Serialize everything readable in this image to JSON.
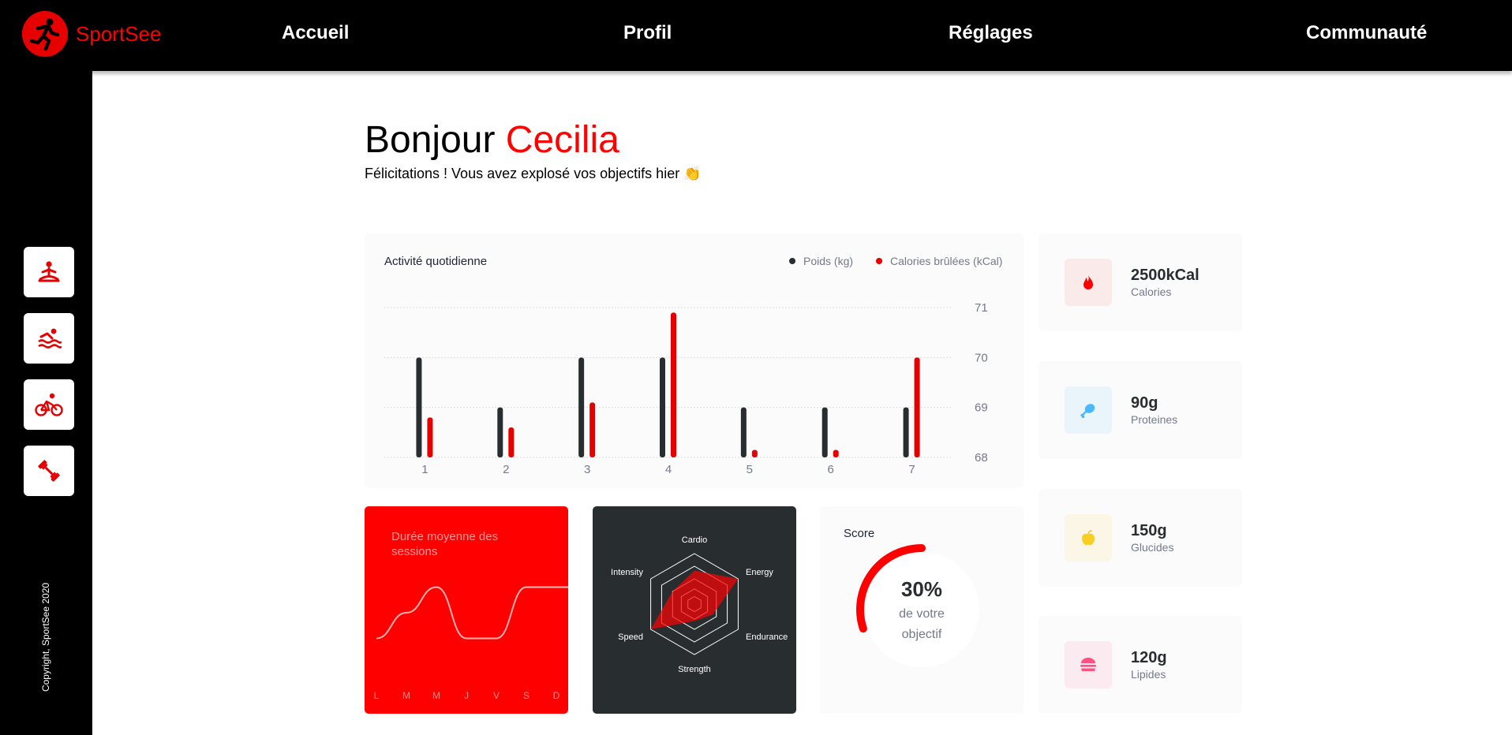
{
  "brand": {
    "name": "SportSee",
    "color": "#ff0101"
  },
  "nav": [
    {
      "label": "Accueil"
    },
    {
      "label": "Profil"
    },
    {
      "label": "Réglages"
    },
    {
      "label": "Communauté"
    }
  ],
  "sidebar": {
    "items": [
      {
        "icon": "yoga-icon"
      },
      {
        "icon": "swimming-icon"
      },
      {
        "icon": "cycling-icon"
      },
      {
        "icon": "dumbbell-icon"
      }
    ],
    "copyright": "Copyright, SportSee 2020"
  },
  "greeting": {
    "hello": "Bonjour",
    "name": "Cecilia",
    "message": "Félicitations ! Vous avez explosé vos objectifs hier 👏"
  },
  "chart_data": [
    {
      "type": "bar",
      "title": "Activité quotidienne",
      "categories": [
        "1",
        "2",
        "3",
        "4",
        "5",
        "6",
        "7"
      ],
      "series": [
        {
          "name": "Poids (kg)",
          "color": "#282d30",
          "values": [
            70,
            69,
            70,
            70,
            69,
            69,
            69
          ]
        },
        {
          "name": "Calories brûlées (kCal)",
          "color": "#e60000",
          "values": [
            68.8,
            68.6,
            69.1,
            70.9,
            68.15,
            68.15,
            70
          ]
        }
      ],
      "ylim": [
        68,
        71
      ],
      "yticks": [
        "68",
        "69",
        "70",
        "71"
      ],
      "grid": "dashed horizontal",
      "legend": "top-right"
    },
    {
      "type": "line",
      "title": "Durée moyenne des sessions",
      "categories": [
        "L",
        "M",
        "M",
        "J",
        "V",
        "S",
        "D"
      ],
      "values": [
        30,
        40,
        50,
        30,
        30,
        50,
        50
      ]
    },
    {
      "type": "radar",
      "categories": [
        "Cardio",
        "Energy",
        "Endurance",
        "Strength",
        "Speed",
        "Intensity"
      ],
      "values": [
        80,
        120,
        50,
        40,
        120,
        60
      ],
      "max": 120
    },
    {
      "type": "radial",
      "title": "Score",
      "value": 30,
      "value_label": "30%",
      "caption_line1": "de votre",
      "caption_line2": "objectif"
    }
  ],
  "key_data": [
    {
      "value": "2500kCal",
      "label": "Calories",
      "icon": "fire-icon",
      "color": "#ff0000",
      "bg": "#fbeaea"
    },
    {
      "value": "90g",
      "label": "Proteines",
      "icon": "chicken-icon",
      "color": "#4ab8ff",
      "bg": "#e9f4fb"
    },
    {
      "value": "150g",
      "label": "Glucides",
      "icon": "apple-icon",
      "color": "#f9ce23",
      "bg": "#fbf6e5"
    },
    {
      "value": "120g",
      "label": "Lipides",
      "icon": "burger-icon",
      "color": "#fd5181",
      "bg": "#fbeaef"
    }
  ]
}
